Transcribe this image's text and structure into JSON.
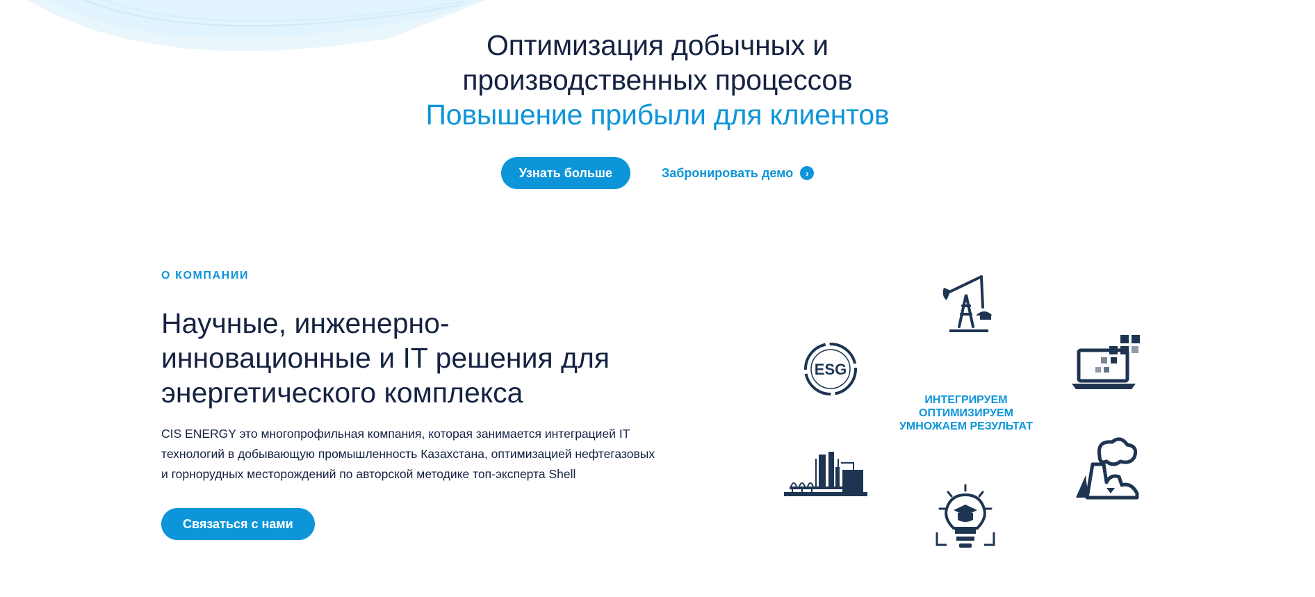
{
  "hero": {
    "title_line1": "Оптимизация добычных и",
    "title_line2": "производственных процессов",
    "subtitle": "Повышение прибыли для клиентов",
    "learn_more_label": "Узнать больше",
    "book_demo_label": "Забронировать демо"
  },
  "about": {
    "eyebrow": "О КОМПАНИИ",
    "title_lines": [
      "Научные, инженерно-",
      "инновационные и IT решения для",
      "энергетического комплекса"
    ],
    "description_lines": [
      "CIS ENERGY это многопрофильная компания, которая занимается интеграцией IT",
      "технологий в добывающую промышленность Казахстана, оптимизацией нефтегазовых",
      "и горнорудных месторождений по авторской методике топ-эксперта Shell"
    ],
    "contact_label": "Связаться с нами"
  },
  "diagram": {
    "center_lines": [
      "ИНТЕГРИРУЕМ",
      "ОПТИМИЗИРУЕМ",
      "УМНОЖАЕМ РЕЗУЛЬТАТ"
    ],
    "esg_label": "ESG",
    "icons": [
      "oil-pump-icon",
      "laptop-pixels-icon",
      "factory-smoke-icon",
      "lightbulb-graduation-icon",
      "refinery-icon",
      "esg-circle-icon"
    ]
  },
  "colors": {
    "accent": "#0d95da",
    "dark": "#152242",
    "icon": "#1e3552"
  }
}
